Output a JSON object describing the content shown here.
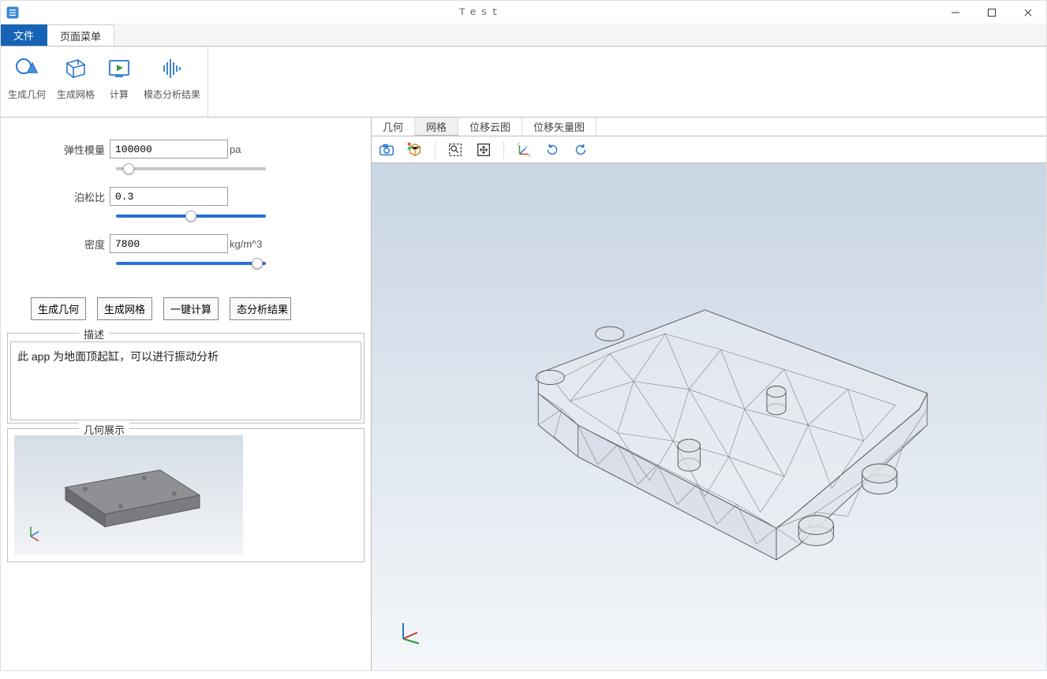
{
  "window": {
    "title": "Test"
  },
  "menu_tabs": {
    "file": "文件",
    "page_menu": "页面菜单"
  },
  "ribbon": {
    "gen_geom": "生成几何",
    "gen_mesh": "生成网格",
    "compute": "计算",
    "modal_result": "模态分析结果"
  },
  "params": {
    "elastic_modulus": {
      "label": "弹性模量",
      "value": "100000",
      "unit": "pa"
    },
    "poisson": {
      "label": "泊松比",
      "value": "0.3",
      "unit": ""
    },
    "density": {
      "label": "密度",
      "value": "7800",
      "unit": "kg/m^3"
    }
  },
  "buttons": {
    "gen_geom": "生成几何",
    "gen_mesh": "生成网格",
    "one_click_calc": "一键计算",
    "modal_result_trunc": "态分析结果"
  },
  "sections": {
    "description_legend": "描述",
    "geom_legend": "几何展示"
  },
  "description_text": "此 app 为地面顶起缸，可以进行振动分析",
  "view_tabs": {
    "geometry": "几何",
    "mesh": "网格",
    "disp_contour": "位移云图",
    "disp_vector": "位移矢量图"
  }
}
